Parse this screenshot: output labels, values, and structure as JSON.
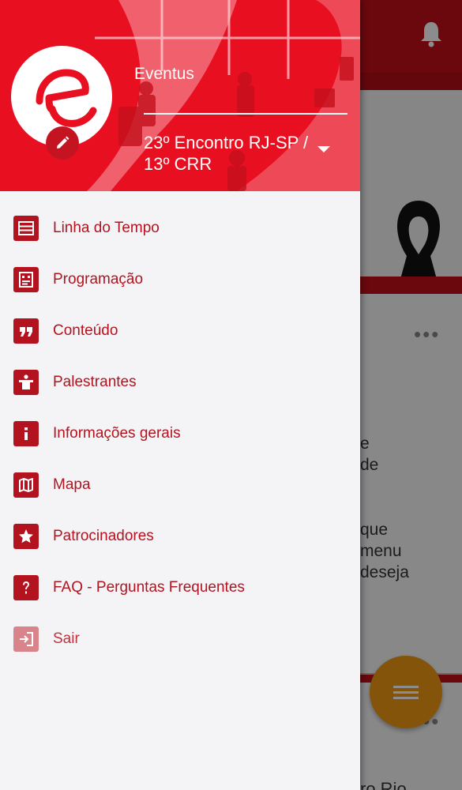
{
  "header": {
    "app_label": "Eventus",
    "event_name": "23º Encontro RJ-SP / 13º CRR"
  },
  "menu": {
    "items": [
      {
        "label": "Linha do Tempo",
        "icon": "timeline-icon"
      },
      {
        "label": "Programação",
        "icon": "schedule-icon"
      },
      {
        "label": "Conteúdo",
        "icon": "quote-icon"
      },
      {
        "label": "Palestrantes",
        "icon": "speaker-podium-icon"
      },
      {
        "label": "Informações gerais",
        "icon": "info-icon"
      },
      {
        "label": "Mapa",
        "icon": "map-icon"
      },
      {
        "label": "Patrocinadores",
        "icon": "star-icon"
      },
      {
        "label": "FAQ - Perguntas Frequentes",
        "icon": "question-icon"
      },
      {
        "label": "Sair",
        "icon": "logout-icon"
      }
    ]
  },
  "background": {
    "text_lines": [
      "e",
      "de",
      "",
      "que",
      "menu",
      "deseja"
    ],
    "bottom_text": "ro Rio"
  },
  "colors": {
    "brand_red": "#e80f21",
    "menu_red": "#b3131f",
    "fab_orange": "#f09a14"
  }
}
